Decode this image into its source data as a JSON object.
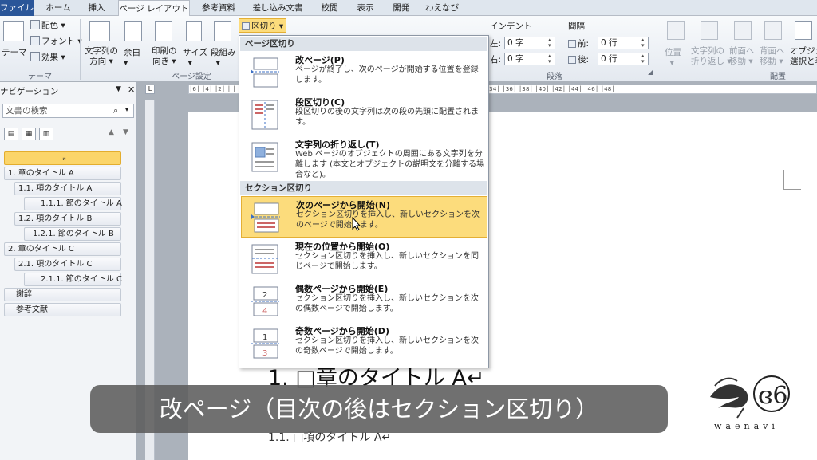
{
  "tabs": [
    "ファイル",
    "ホーム",
    "挿入",
    "ページ レイアウト",
    "参考資料",
    "差し込み文書",
    "校閲",
    "表示",
    "開発",
    "わえなび"
  ],
  "ribbon": {
    "theme_group": {
      "label": "テーマ",
      "btn": "テーマ",
      "colors": "配色",
      "fonts": "フォント",
      "effects": "効果"
    },
    "setup_group": {
      "label": "ページ設定",
      "text_dir": [
        "文字列の",
        "方向"
      ],
      "margins": "余白",
      "orientation": [
        "印刷の",
        "向き"
      ],
      "size": "サイズ",
      "columns": "段組み",
      "breaks": "区切り"
    },
    "paragraph_group": {
      "label": "段落",
      "indent_label": "インデント",
      "spacing_label": "間隔",
      "left_label": "左:",
      "right_label": "右:",
      "left_val": "0 字",
      "right_val": "0 字",
      "before_label": "前:",
      "after_label": "後:",
      "before_val": "0 行",
      "after_val": "0 行"
    },
    "arrange_group": {
      "label": "配置",
      "position": "位置",
      "wrap": [
        "文字列の",
        "折り返し"
      ],
      "forward": [
        "前面へ",
        "移動"
      ],
      "backward": [
        "背面へ",
        "移動"
      ],
      "selection": [
        "オブジェク",
        "選択と表"
      ]
    }
  },
  "nav": {
    "title": "ナビゲーション",
    "search_placeholder": "文書の検索",
    "nodes": [
      "",
      "1.  章のタイトル A",
      "1.1.  項のタイトル A",
      "1.1.1.  節のタイトル A",
      "1.2.  項のタイトル B",
      "1.2.1.  節のタイトル B",
      "2.  章のタイトル C",
      "2.1.  項のタイトル C",
      "2.1.1.  節のタイトル C",
      "謝辞",
      "参考文献"
    ]
  },
  "ruler": {
    "left": "L",
    "marks": "│6│ │4│ │2│ │ │ │2│ │4│ │6│ │8│ │10│ │12│ │14│ │16│ │18│ │20│ │22│ │24│ │26│ │28│ │30│ │32│ │34│ │36│ │38│ │40│ │42│ │44│ │46│ │48│"
  },
  "dropdown": {
    "section1": "ページ区切り",
    "section2": "セクション区切り",
    "items": [
      {
        "title": "改ページ(P)",
        "desc": "ページが終了し、次のページが開始する位置を登録します。"
      },
      {
        "title": "段区切り(C)",
        "desc": "段区切りの後の文字列は次の段の先頭に配置されます。"
      },
      {
        "title": "文字列の折り返し(T)",
        "desc": "Web ページのオブジェクトの周囲にある文字列を分離します (本文とオブジェクトの説明文を分離する場合など)。"
      },
      {
        "title": "次のページから開始(N)",
        "desc": "セクション区切りを挿入し、新しいセクションを次のページで開始します。"
      },
      {
        "title": "現在の位置から開始(O)",
        "desc": "セクション区切りを挿入し、新しいセクションを同じページで開始します。"
      },
      {
        "title": "偶数ページから開始(E)",
        "desc": "セクション区切りを挿入し、新しいセクションを次の偶数ページで開始します。"
      },
      {
        "title": "奇数ページから開始(D)",
        "desc": "セクション区切りを挿入し、新しいセクションを次の奇数ページで開始します。"
      }
    ]
  },
  "document": {
    "h1": "1. □章のタイトル A↵",
    "h2": "1.1. □項のタイトル A↵"
  },
  "subtitle": "改ページ（目次の後はセクション区切り）",
  "logo_text": "waenavi",
  "colors": {
    "file_tab": "#2a5699",
    "highlight": "#fcdc7c",
    "subtitle_bg": "#5c5c5c"
  }
}
